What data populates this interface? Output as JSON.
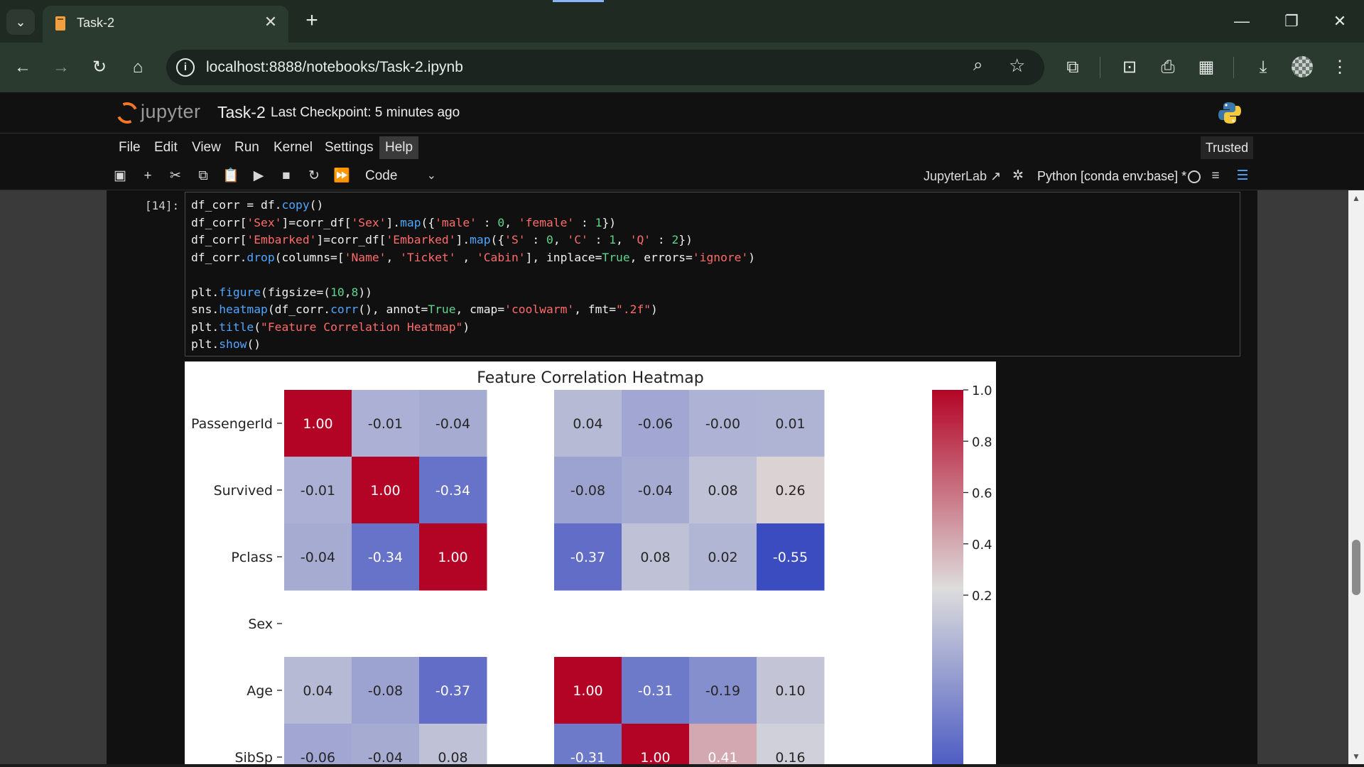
{
  "browser": {
    "tab_title": "Task-2",
    "url": "localhost:8888/notebooks/Task-2.ipynb"
  },
  "jupyter": {
    "logo_text": "jupyter",
    "notebook_name": "Task-2",
    "checkpoint": "Last Checkpoint: 5 minutes ago",
    "menu": [
      "File",
      "Edit",
      "View",
      "Run",
      "Kernel",
      "Settings",
      "Help"
    ],
    "active_menu": "Help",
    "trusted": "Trusted",
    "cell_type": "Code",
    "jupyterlab_link": "JupyterLab",
    "kernel_name": "Python [conda env:base] *"
  },
  "cell": {
    "prompt": "[14]:",
    "code_lines": [
      "df_corr = df.copy()",
      "df_corr['Sex']=corr_df['Sex'].map({'male' : 0, 'female' : 1})",
      "df_corr['Embarked']=corr_df['Embarked'].map({'S' : 0, 'C' : 1, 'Q' : 2})",
      "df_corr.drop(columns=['Name', 'Ticket' , 'Cabin'], inplace=True, errors='ignore')",
      "",
      "plt.figure(figsize=(10,8))",
      "sns.heatmap(df_corr.corr(), annot=True, cmap='coolwarm', fmt=\".2f\")",
      "plt.title(\"Feature Correlation Heatmap\")",
      "plt.show()"
    ]
  },
  "chart_data": {
    "type": "heatmap",
    "title": "Feature Correlation Heatmap",
    "rows": [
      "PassengerId",
      "Survived",
      "Pclass",
      "Sex",
      "Age",
      "SibSp"
    ],
    "values": [
      [
        1.0,
        -0.01,
        -0.04,
        null,
        0.04,
        -0.06,
        -0.0,
        0.01
      ],
      [
        -0.01,
        1.0,
        -0.34,
        null,
        -0.08,
        -0.04,
        0.08,
        0.26
      ],
      [
        -0.04,
        -0.34,
        1.0,
        null,
        -0.37,
        0.08,
        0.02,
        -0.55
      ],
      [
        null,
        null,
        null,
        null,
        null,
        null,
        null,
        null
      ],
      [
        0.04,
        -0.08,
        -0.37,
        null,
        1.0,
        -0.31,
        -0.19,
        0.1
      ],
      [
        -0.06,
        -0.04,
        0.08,
        null,
        -0.31,
        1.0,
        0.41,
        0.16
      ]
    ],
    "labels": [
      [
        "1.00",
        "-0.01",
        "-0.04",
        "",
        "0.04",
        "-0.06",
        "-0.00",
        "0.01"
      ],
      [
        "-0.01",
        "1.00",
        "-0.34",
        "",
        "-0.08",
        "-0.04",
        "0.08",
        "0.26"
      ],
      [
        "-0.04",
        "-0.34",
        "1.00",
        "",
        "-0.37",
        "0.08",
        "0.02",
        "-0.55"
      ],
      [
        "",
        "",
        "",
        "",
        "",
        "",
        "",
        ""
      ],
      [
        "0.04",
        "-0.08",
        "-0.37",
        "",
        "1.00",
        "-0.31",
        "-0.19",
        "0.10"
      ],
      [
        "-0.06",
        "-0.04",
        "0.08",
        "",
        "-0.31",
        "1.00",
        "0.41",
        "0.16"
      ]
    ],
    "colorbar_ticks": [
      "1.0",
      "0.8",
      "0.6",
      "0.4",
      "0.2"
    ],
    "colorbar_values": [
      1.0,
      0.8,
      0.6,
      0.4,
      0.2
    ],
    "cmap": "coolwarm",
    "colors": {
      "high": "#b40426",
      "mid": "#dddcdc",
      "low": "#3b4cc0"
    }
  }
}
